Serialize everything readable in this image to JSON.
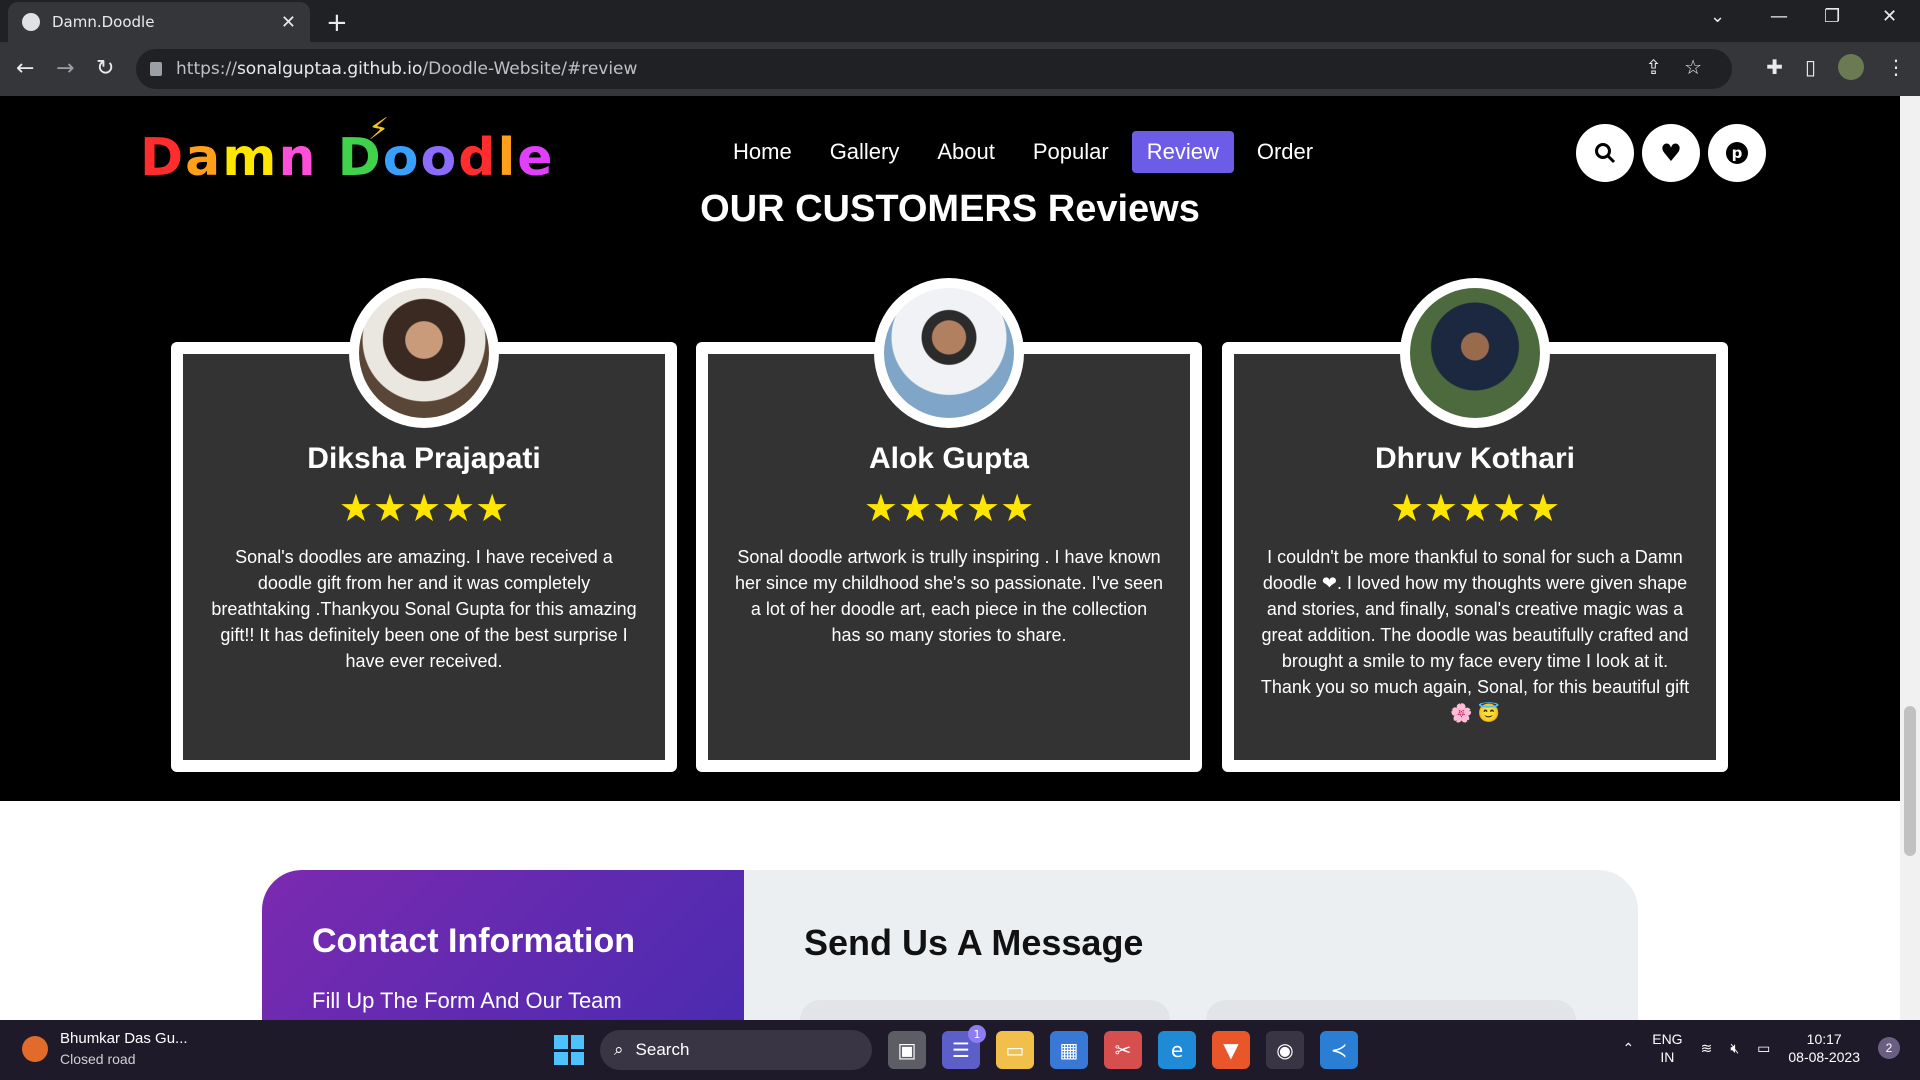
{
  "browser": {
    "tab_title": "Damn.Doodle",
    "url_prefix": "https://",
    "url_host": "sonalguptaa.github.io",
    "url_path": "/Doodle-Website/#review"
  },
  "site": {
    "logo_text": "Damn Doodle",
    "nav": [
      "Home",
      "Gallery",
      "About",
      "Popular",
      "Review",
      "Order"
    ],
    "active_nav": "Review",
    "section_title": "OUR CUSTOMERS Reviews"
  },
  "reviews": [
    {
      "name": "Diksha Prajapati",
      "stars": "★★★★★",
      "text": "Sonal's doodles are amazing. I have received a doodle gift from her and it was completely breathtaking .Thankyou Sonal Gupta for this amazing gift!! It has definitely been one of the best surprise I have ever received."
    },
    {
      "name": "Alok Gupta",
      "stars": "★★★★★",
      "text": "Sonal doodle artwork is trully inspiring . I have known her since my childhood she's so passionate. I've seen a lot of her doodle art, each piece in the collection has so many stories to share."
    },
    {
      "name": "Dhruv Kothari",
      "stars": "★★★★★",
      "text": "I couldn't be more thankful to sonal for such a Damn doodle ❤. I loved how my thoughts were given shape and stories, and finally, sonal's creative magic was a great addition. The doodle was beautifully crafted and brought a smile to my face every time I look at it. Thank you so much again, Sonal, for this beautiful gift 🌸 😇"
    }
  ],
  "contact": {
    "title": "Contact Information",
    "subtitle": "Fill Up The Form And Our Team",
    "message_title": "Send Us A Message"
  },
  "taskbar": {
    "weather_title": "Bhumkar Das Gu...",
    "weather_sub": "Closed road",
    "search_label": "Search",
    "lang_top": "ENG",
    "lang_bottom": "IN",
    "time": "10:17",
    "date": "08-08-2023",
    "notification_count": "2",
    "teams_badge": "1"
  },
  "colors": {
    "accent_nav": "#6c5ce7",
    "stars": "#ffe600",
    "card_bg": "#333333",
    "contact_gradient_start": "#7b2ab0",
    "contact_gradient_end": "#4a2bb0"
  }
}
